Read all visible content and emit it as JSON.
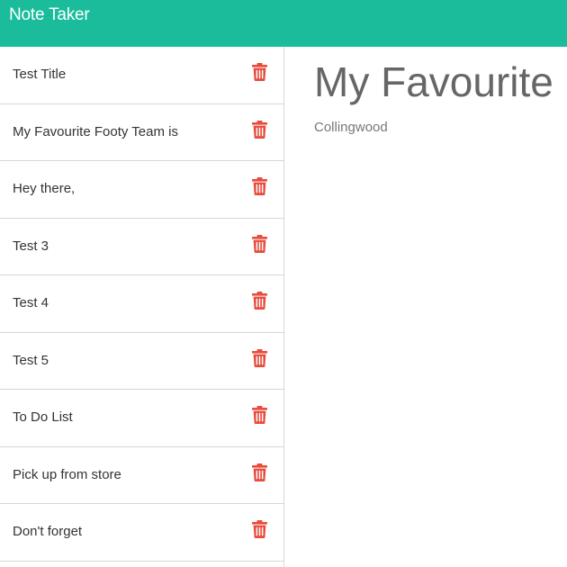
{
  "app": {
    "title": "Note Taker"
  },
  "colors": {
    "navbar": "#1abc9c",
    "delete_icon": "#e74c3c"
  },
  "sidebar": {
    "notes": [
      {
        "title": "Test Title",
        "icon": "trash-icon"
      },
      {
        "title": "My Favourite Footy Team is",
        "icon": "trash-icon"
      },
      {
        "title": "Hey there,",
        "icon": "trash-icon"
      },
      {
        "title": "Test 3",
        "icon": "trash-icon"
      },
      {
        "title": "Test 4",
        "icon": "trash-icon"
      },
      {
        "title": "Test 5",
        "icon": "trash-icon"
      },
      {
        "title": "To Do List",
        "icon": "trash-icon"
      },
      {
        "title": "Pick up from store",
        "icon": "trash-icon"
      },
      {
        "title": "Don't forget",
        "icon": "trash-icon"
      }
    ]
  },
  "active_note": {
    "title": "My Favourite Footy Team is",
    "text": "Collingwood"
  }
}
